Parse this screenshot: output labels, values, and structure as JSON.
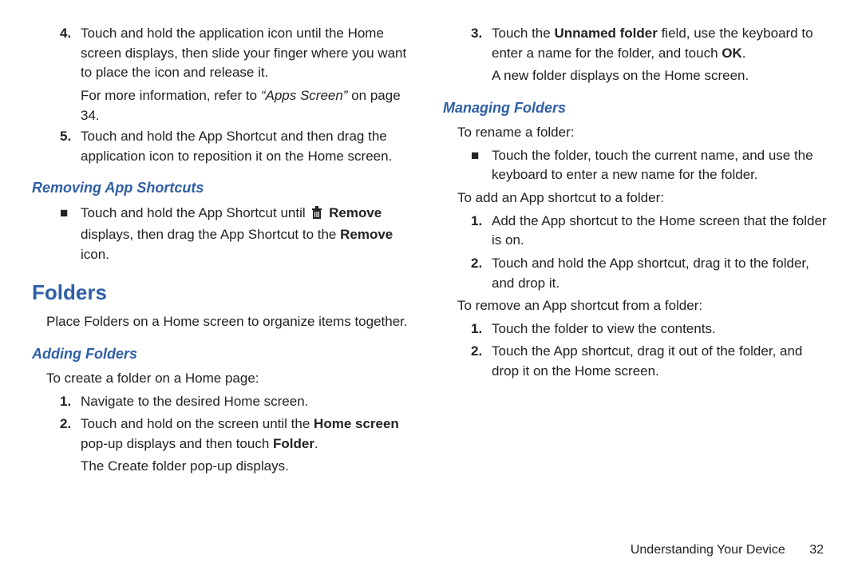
{
  "left": {
    "items45": {
      "i4": {
        "num": "4.",
        "body_a": "Touch and hold the application icon until the Home screen displays, then slide your finger where you want to place the icon and release it.",
        "note_a": "For more information, refer to ",
        "note_q": "“Apps Screen” ",
        "note_b": "on page 34."
      },
      "i5": {
        "num": "5.",
        "body": "Touch and hold the App Shortcut and then drag the application icon to reposition it on the Home screen."
      }
    },
    "removing": {
      "title": "Removing App Shortcuts",
      "bullet": {
        "mark": "■",
        "seg_a": "Touch and hold the App Shortcut until ",
        "icon_name": "trash-icon",
        "seg_remove1": " Remove",
        "seg_b": " displays, then drag the App Shortcut to the ",
        "seg_remove2": "Remove",
        "seg_c": " icon."
      }
    },
    "folders": {
      "title": "Folders",
      "intro": "Place Folders on a Home screen to organize items together."
    },
    "adding": {
      "title": "Adding Folders",
      "lead": "To create a folder on a Home page:",
      "i1": {
        "num": "1.",
        "body": "Navigate to the desired Home screen."
      },
      "i2": {
        "num": "2.",
        "seg_a": "Touch and hold on the screen until the ",
        "seg_home": "Home screen",
        "seg_b": " pop-up displays and then touch ",
        "seg_folder": "Folder",
        "seg_c": ".",
        "tail": "The Create folder pop-up displays."
      }
    }
  },
  "right": {
    "i3": {
      "num": "3.",
      "seg_a": "Touch the ",
      "seg_un": "Unnamed folder",
      "seg_b": " field, use the keyboard to enter a name for the folder, and touch ",
      "seg_ok": "OK",
      "seg_c": ".",
      "tail": "A new folder displays on the Home screen."
    },
    "managing": {
      "title": "Managing Folders",
      "rename_lead": "To rename a folder:",
      "rename_bullet": {
        "mark": "■",
        "body": "Touch the folder, touch the current name, and use the keyboard to enter a new name for the folder."
      },
      "add_lead": "To add an App shortcut to a folder:",
      "add_i1": {
        "num": "1.",
        "body": "Add the App shortcut to the Home screen that the folder is on."
      },
      "add_i2": {
        "num": "2.",
        "body": "Touch and hold the App shortcut, drag it to the folder, and drop it."
      },
      "remove_lead": "To remove an App shortcut from a folder:",
      "remove_i1": {
        "num": "1.",
        "body": "Touch the folder to view the contents."
      },
      "remove_i2": {
        "num": "2.",
        "body": "Touch the App shortcut, drag it out of the folder, and drop it on the Home screen."
      }
    }
  },
  "footer": {
    "section": "Understanding Your Device",
    "page": "32"
  }
}
